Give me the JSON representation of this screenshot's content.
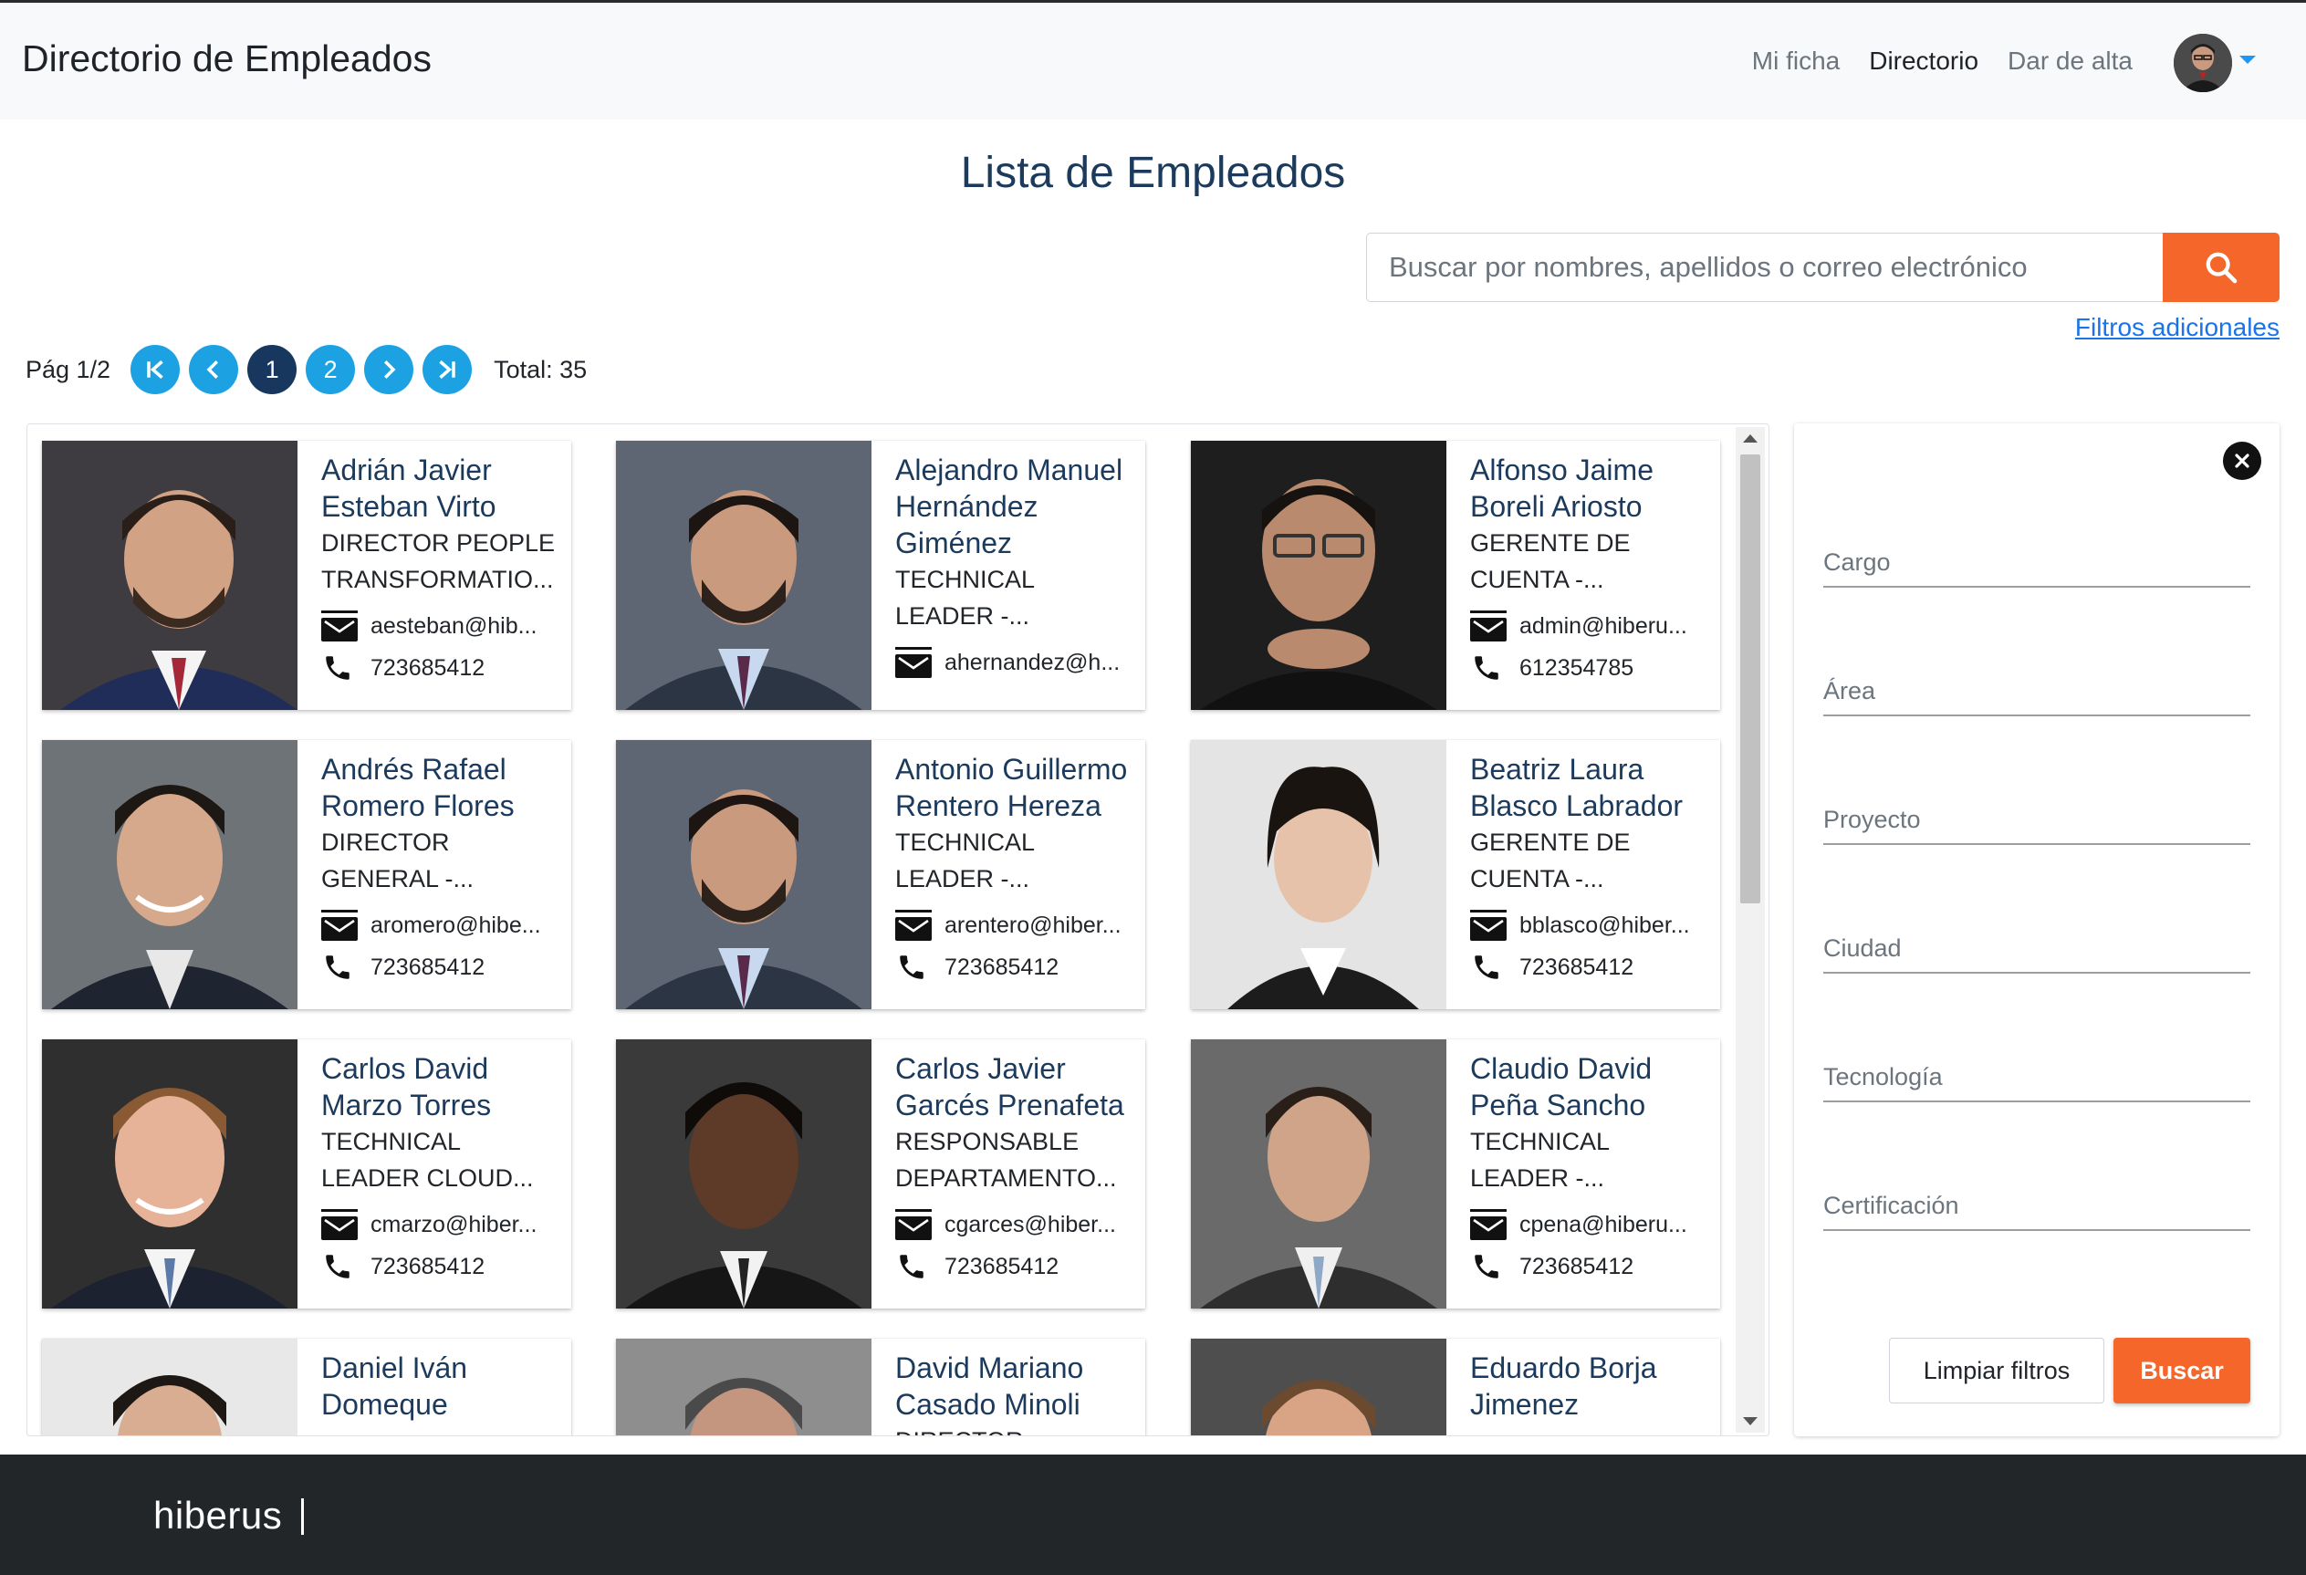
{
  "header": {
    "brand": "Directorio de Empleados",
    "nav": [
      {
        "label": "Mi ficha",
        "active": false
      },
      {
        "label": "Directorio",
        "active": true
      },
      {
        "label": "Dar de alta",
        "active": false
      }
    ]
  },
  "title": "Lista de Empleados",
  "search": {
    "placeholder": "Buscar por nombres, apellidos o correo electrónico",
    "filters_link": "Filtros adicionales"
  },
  "pagination": {
    "label": "Pág 1/2",
    "pages": [
      "1",
      "2"
    ],
    "current": "1",
    "total": "Total: 35"
  },
  "employees": [
    {
      "name": "Adrián Javier Esteban Virto",
      "role": "DIRECTOR PEOPLE TRANSFORMATIO...",
      "email": "aesteban@hib...",
      "phone": "723685412"
    },
    {
      "name": "Alejandro Manuel Hernández Giménez",
      "role": "TECHNICAL LEADER -...",
      "email": "ahernandez@h...",
      "phone": ""
    },
    {
      "name": "Alfonso Jaime Boreli Ariosto",
      "role": "GERENTE DE CUENTA -...",
      "email": "admin@hiberu...",
      "phone": "612354785"
    },
    {
      "name": "Andrés Rafael Romero Flores",
      "role": "DIRECTOR GENERAL -...",
      "email": "aromero@hibe...",
      "phone": "723685412"
    },
    {
      "name": "Antonio Guillermo Rentero Hereza",
      "role": "TECHNICAL LEADER -...",
      "email": "arentero@hiber...",
      "phone": "723685412"
    },
    {
      "name": "Beatriz Laura Blasco Labrador",
      "role": "GERENTE DE CUENTA -...",
      "email": "bblasco@hiber...",
      "phone": "723685412"
    },
    {
      "name": "Carlos David Marzo Torres",
      "role": "TECHNICAL LEADER CLOUD...",
      "email": "cmarzo@hiber...",
      "phone": "723685412"
    },
    {
      "name": "Carlos Javier Garcés Prenafeta",
      "role": "RESPONSABLE DEPARTAMENTO...",
      "email": "cgarces@hiber...",
      "phone": "723685412"
    },
    {
      "name": "Claudio David Peña Sancho",
      "role": "TECHNICAL LEADER -...",
      "email": "cpena@hiberu...",
      "phone": "723685412"
    },
    {
      "name": "Daniel Iván Domeque",
      "role": "",
      "email": "",
      "phone": ""
    },
    {
      "name": "David Mariano Casado Minoli",
      "role": "DIRECTOR",
      "email": "",
      "phone": ""
    },
    {
      "name": "Eduardo Borja Jimenez",
      "role": "",
      "email": "",
      "phone": ""
    }
  ],
  "filters": {
    "fields": [
      "Cargo",
      "Área",
      "Proyecto",
      "Ciudad",
      "Tecnología",
      "Certificación"
    ],
    "clear_label": "Limpiar filtros",
    "search_label": "Buscar"
  },
  "footer": {
    "logo": "hiberus"
  },
  "colors": {
    "accent": "#f4662a",
    "pagination": "#1ca2e3",
    "pagination_current": "#17375e",
    "title": "#1b3a5c",
    "footer": "#232629"
  }
}
